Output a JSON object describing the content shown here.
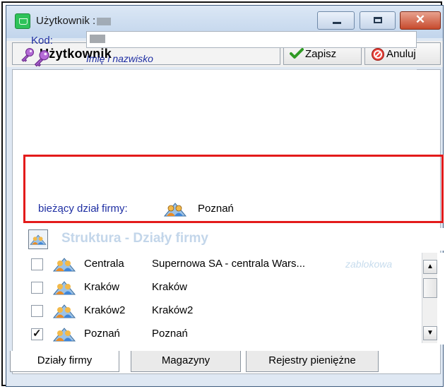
{
  "window": {
    "title": "Użytkownik :",
    "controls": [
      "minimize",
      "maximize",
      "close"
    ],
    "close_glyph": "✕"
  },
  "toolbar": {
    "title": "Użytkownik",
    "title_icon": "key-icon",
    "save_label": "Zapisz",
    "cancel_label": "Anuluj"
  },
  "form": {
    "code_label": "Kod:",
    "name_placeholder": "Imię i nazwisko",
    "current_dept_label": "bieżący dział firmy:",
    "current_dept_value": "Poznań"
  },
  "structure": {
    "title": "Struktura - Działy firmy",
    "rows": [
      {
        "code": "Centrala",
        "name": "Supernowa SA - centrala Wars...",
        "status": "zablokowa",
        "checked": false
      },
      {
        "code": "Kraków",
        "name": "Kraków",
        "status": "",
        "checked": false
      },
      {
        "code": "Kraków2",
        "name": "Kraków2",
        "status": "",
        "checked": false
      },
      {
        "code": "Poznań",
        "name": "Poznań",
        "status": "",
        "checked": true
      }
    ]
  },
  "tabs": [
    {
      "label": "Działy firmy",
      "active": true
    },
    {
      "label": "Magazyny",
      "active": false
    },
    {
      "label": "Rejestry pieniężne",
      "active": false
    }
  ],
  "colors": {
    "label_blue": "#1f2fa3",
    "highlight_red": "#e31b1b",
    "header_faded": "#c3d6ea",
    "close_red": "#c74a2d"
  }
}
